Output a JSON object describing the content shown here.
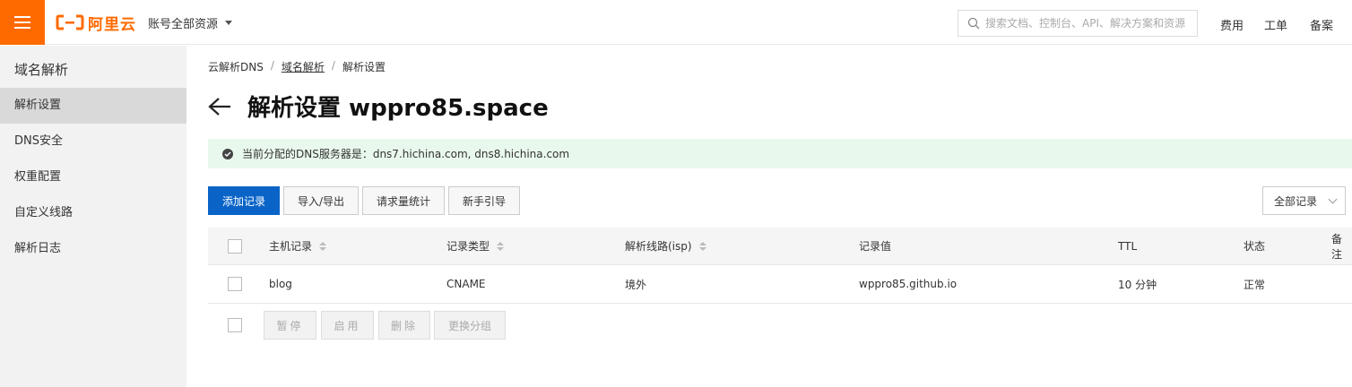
{
  "colors": {
    "brand": "#ff6a00",
    "primary": "#0a64c8",
    "success_bg": "#e9f8ec"
  },
  "header": {
    "logo_text": "阿里云",
    "account_label": "账号全部资源",
    "search_placeholder": "搜索文档、控制台、API、解决方案和资源",
    "links": [
      "费用",
      "工单",
      "备案"
    ]
  },
  "sidebar": {
    "title": "域名解析",
    "items": [
      {
        "label": "解析设置",
        "active": true
      },
      {
        "label": "DNS安全"
      },
      {
        "label": "权重配置"
      },
      {
        "label": "自定义线路"
      },
      {
        "label": "解析日志"
      }
    ]
  },
  "breadcrumb": {
    "root": "云解析DNS",
    "parent": "域名解析",
    "current": "解析设置",
    "separator": "/"
  },
  "page": {
    "title": "解析设置 wppro85.space",
    "notice": "当前分配的DNS服务器是：dns7.hichina.com, dns8.hichina.com"
  },
  "toolbar": {
    "add": "添加记录",
    "import_export": "导入/导出",
    "stats": "请求量统计",
    "guide": "新手引导",
    "filter": "全部记录"
  },
  "table": {
    "columns": [
      "主机记录",
      "记录类型",
      "解析线路(isp)",
      "记录值",
      "TTL",
      "状态",
      "备注"
    ],
    "rows": [
      {
        "host": "blog",
        "type": "CNAME",
        "line": "境外",
        "value": "wppro85.github.io",
        "ttl": "10 分钟",
        "status": "正常",
        "remark": ""
      }
    ]
  },
  "batch": {
    "pause": "暂停",
    "enable": "启用",
    "delete": "删除",
    "group": "更换分组"
  }
}
